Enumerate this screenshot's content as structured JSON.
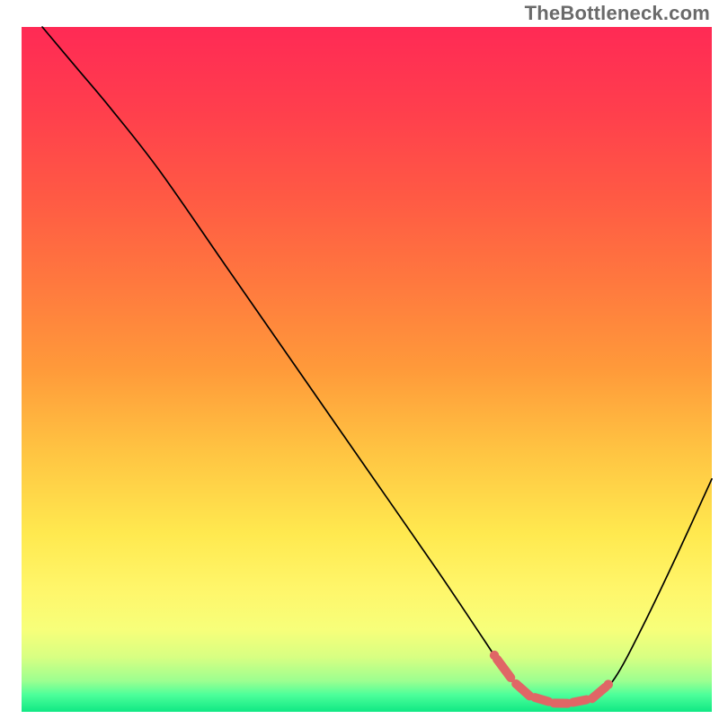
{
  "watermark": "TheBottleneck.com",
  "chart_data": {
    "type": "line",
    "title": "",
    "xlabel": "",
    "ylabel": "",
    "xlim": [
      0,
      100
    ],
    "ylim": [
      0,
      100
    ],
    "background_gradient": {
      "stops": [
        {
          "offset": 0.0,
          "color": "#ff2a55"
        },
        {
          "offset": 0.12,
          "color": "#ff3e4d"
        },
        {
          "offset": 0.25,
          "color": "#ff5a44"
        },
        {
          "offset": 0.38,
          "color": "#ff7a3e"
        },
        {
          "offset": 0.5,
          "color": "#ff9a3a"
        },
        {
          "offset": 0.62,
          "color": "#ffc442"
        },
        {
          "offset": 0.74,
          "color": "#ffe94f"
        },
        {
          "offset": 0.82,
          "color": "#fff66a"
        },
        {
          "offset": 0.88,
          "color": "#f7ff7a"
        },
        {
          "offset": 0.92,
          "color": "#d8ff82"
        },
        {
          "offset": 0.955,
          "color": "#9cff90"
        },
        {
          "offset": 0.975,
          "color": "#4dff9a"
        },
        {
          "offset": 1.0,
          "color": "#10e884"
        }
      ]
    },
    "optimal_band": {
      "x_start": 68.5,
      "x_end": 85.0,
      "color": "#e06666",
      "segment_count": 6
    },
    "series": [
      {
        "name": "bottleneck-curve",
        "color": "#000000",
        "stroke_width": 1.7,
        "x": [
          3.0,
          8.0,
          13.0,
          20.0,
          30.0,
          40.0,
          50.0,
          60.0,
          67.0,
          70.0,
          73.0,
          78.0,
          83.0,
          86.0,
          90.0,
          95.0,
          100.0
        ],
        "y": [
          100.0,
          94.0,
          88.0,
          79.0,
          64.5,
          50.0,
          35.5,
          21.0,
          10.5,
          6.0,
          2.5,
          1.0,
          2.0,
          5.0,
          12.5,
          23.0,
          34.0
        ]
      }
    ]
  }
}
